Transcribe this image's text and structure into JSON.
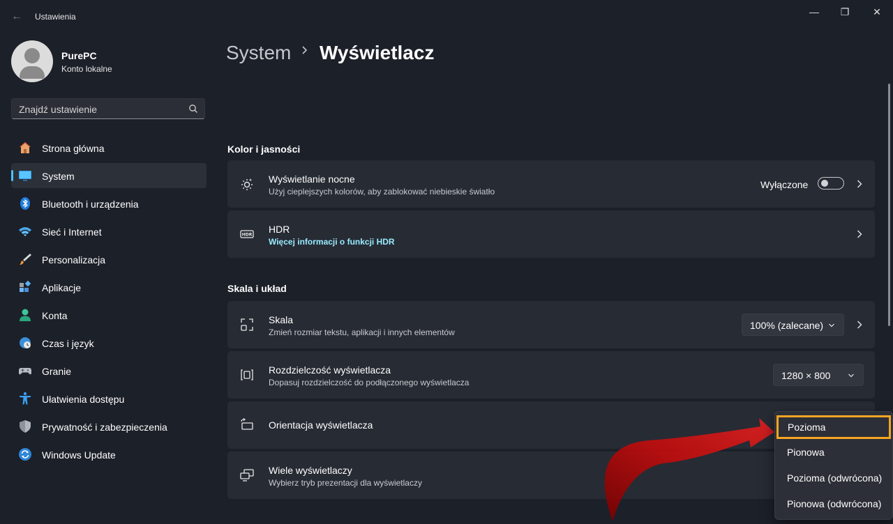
{
  "window": {
    "title": "Ustawienia",
    "minimize": "—",
    "maximize": "❐",
    "close": "✕"
  },
  "user": {
    "name": "PurePC",
    "account_type": "Konto lokalne"
  },
  "search": {
    "placeholder": "Znajdź ustawienie"
  },
  "nav": {
    "items": [
      {
        "label": "Strona główna",
        "icon": "home-icon"
      },
      {
        "label": "System",
        "icon": "system-monitor-icon",
        "active": true
      },
      {
        "label": "Bluetooth i urządzenia",
        "icon": "bluetooth-icon"
      },
      {
        "label": "Sieć i Internet",
        "icon": "wifi-icon"
      },
      {
        "label": "Personalizacja",
        "icon": "brush-icon"
      },
      {
        "label": "Aplikacje",
        "icon": "apps-icon"
      },
      {
        "label": "Konta",
        "icon": "account-icon"
      },
      {
        "label": "Czas i język",
        "icon": "clock-globe-icon"
      },
      {
        "label": "Granie",
        "icon": "gamepad-icon"
      },
      {
        "label": "Ułatwienia dostępu",
        "icon": "accessibility-icon"
      },
      {
        "label": "Prywatność i zabezpieczenia",
        "icon": "shield-icon"
      },
      {
        "label": "Windows Update",
        "icon": "update-icon"
      }
    ]
  },
  "breadcrumb": {
    "parent": "System",
    "current": "Wyświetlacz"
  },
  "sections": {
    "color": {
      "title": "Kolor i jasności"
    },
    "layout": {
      "title": "Skala i układ"
    }
  },
  "cards": {
    "night_light": {
      "title": "Wyświetlanie nocne",
      "subtitle": "Użyj cieplejszych kolorów, aby zablokować niebieskie światło",
      "toggle_label": "Wyłączone",
      "toggle_on": false
    },
    "hdr": {
      "title": "HDR",
      "link": "Więcej informacji o funkcji HDR"
    },
    "scale": {
      "title": "Skala",
      "subtitle": "Zmień rozmiar tekstu, aplikacji i innych elementów",
      "value": "100% (zalecane)"
    },
    "resolution": {
      "title": "Rozdzielczość wyświetlacza",
      "subtitle": "Dopasuj rozdzielczość do podłączonego wyświetlacza",
      "value": "1280 × 800"
    },
    "orientation": {
      "title": "Orientacja wyświetlacza"
    },
    "multi": {
      "title": "Wiele wyświetlaczy",
      "subtitle": "Wybierz tryb prezentacji dla wyświetlaczy"
    }
  },
  "orientation_menu": {
    "options": [
      "Pozioma",
      "Pionowa",
      "Pozioma (odwrócona)",
      "Pionowa (odwrócona)"
    ],
    "highlighted": "Pozioma"
  },
  "colors": {
    "accent": "#4cc2ff",
    "link": "#99ebff",
    "highlight_border": "#f5a623",
    "arrow": "#d11010"
  }
}
